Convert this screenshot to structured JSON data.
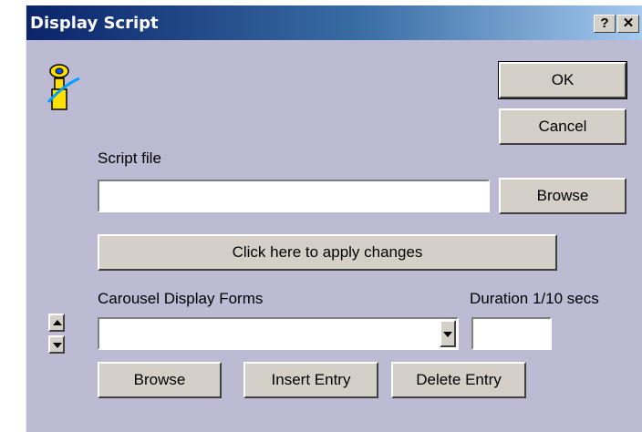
{
  "window": {
    "title": "Display Script"
  },
  "titlebar": {
    "help_label": "?",
    "close_label": "✕"
  },
  "buttons": {
    "ok": "OK",
    "cancel": "Cancel",
    "browse_script": "Browse",
    "apply": "Click here to apply changes",
    "browse_form": "Browse",
    "insert": "Insert Entry",
    "delete": "Delete Entry"
  },
  "labels": {
    "script_file": "Script file",
    "carousel": "Carousel Display Forms",
    "duration": "Duration 1/10 secs"
  },
  "fields": {
    "script_file": "",
    "carousel_form": "",
    "duration": ""
  },
  "icons": {
    "app": "carousel-wizard-icon"
  },
  "colors": {
    "dialog_bg": "#bdbad3",
    "titlebar_start": "#0a246a",
    "titlebar_end": "#a6caf0"
  }
}
